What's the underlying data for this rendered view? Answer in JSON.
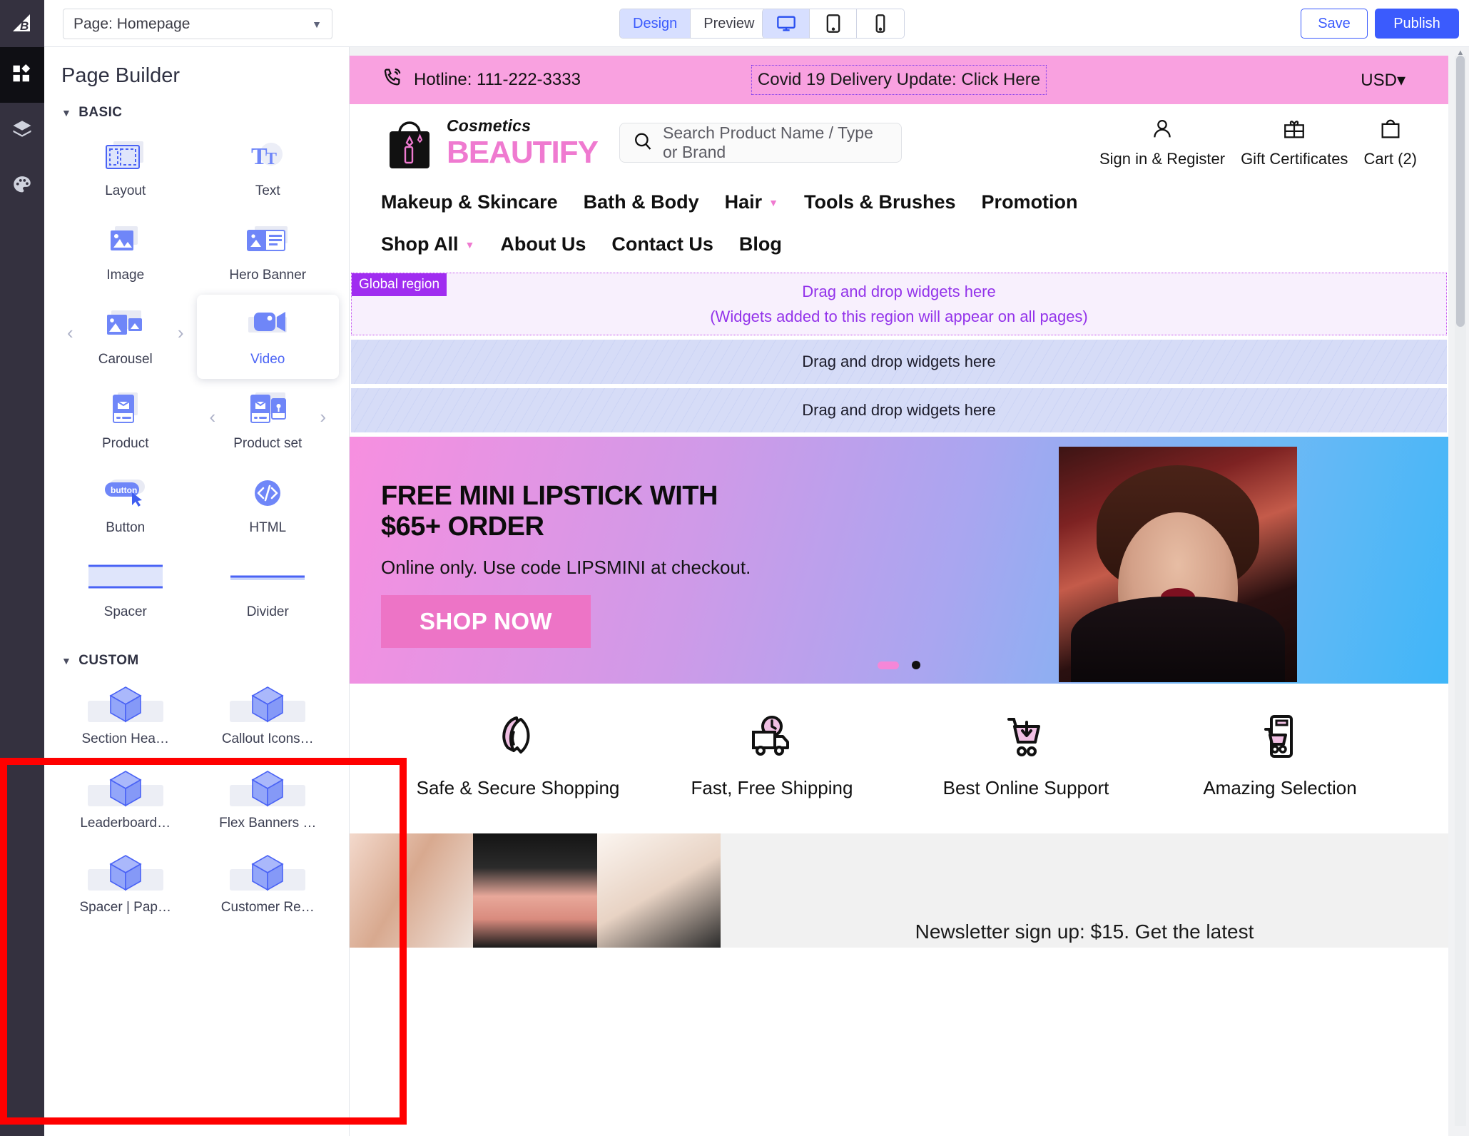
{
  "topbar": {
    "logo_icon": "bigcommerce-logo-icon",
    "page_selector": {
      "value": "Page: Homepage",
      "caret": "▼"
    },
    "mode_tabs": [
      {
        "label": "Design",
        "active": true
      },
      {
        "label": "Preview",
        "active": false
      }
    ],
    "device_tabs": [
      {
        "icon": "desktop-icon",
        "active": true
      },
      {
        "icon": "tablet-icon",
        "active": false
      },
      {
        "icon": "mobile-icon",
        "active": false
      }
    ],
    "save_label": "Save",
    "publish_label": "Publish"
  },
  "rail": {
    "items": [
      {
        "icon": "widgets-grid-icon",
        "active": true
      },
      {
        "icon": "layers-icon",
        "active": false
      },
      {
        "icon": "theme-palette-icon",
        "active": false
      }
    ]
  },
  "panel": {
    "title": "Page Builder",
    "groups": [
      {
        "name": "BASIC",
        "collapse_caret": "▼",
        "widgets": [
          {
            "label": "Layout",
            "icon": "layout-icon",
            "selected": false,
            "arrows": false
          },
          {
            "label": "Text",
            "icon": "text-icon",
            "selected": false,
            "arrows": false
          },
          {
            "label": "Image",
            "icon": "image-icon",
            "selected": false,
            "arrows": false
          },
          {
            "label": "Hero Banner",
            "icon": "hero-banner-icon",
            "selected": false,
            "arrows": false
          },
          {
            "label": "Carousel",
            "icon": "carousel-icon",
            "selected": false,
            "arrows": true
          },
          {
            "label": "Video",
            "icon": "video-icon",
            "selected": true,
            "arrows": false
          },
          {
            "label": "Product",
            "icon": "product-icon",
            "selected": false,
            "arrows": false
          },
          {
            "label": "Product set",
            "icon": "product-set-icon",
            "selected": false,
            "arrows": true
          },
          {
            "label": "Button",
            "icon": "button-icon",
            "selected": false,
            "arrows": false
          },
          {
            "label": "HTML",
            "icon": "html-code-icon",
            "selected": false,
            "arrows": false
          },
          {
            "label": "Spacer",
            "icon": "spacer-icon",
            "selected": false,
            "arrows": false
          },
          {
            "label": "Divider",
            "icon": "divider-icon",
            "selected": false,
            "arrows": false
          }
        ]
      },
      {
        "name": "CUSTOM",
        "collapse_caret": "▼",
        "widgets": [
          {
            "label": "Section Hea…",
            "icon": "cube-icon",
            "selected": false,
            "arrows": false
          },
          {
            "label": "Callout Icons…",
            "icon": "cube-icon",
            "selected": false,
            "arrows": false
          },
          {
            "label": "Leaderboard…",
            "icon": "cube-icon",
            "selected": false,
            "arrows": false
          },
          {
            "label": "Flex Banners …",
            "icon": "cube-icon",
            "selected": false,
            "arrows": false
          },
          {
            "label": "Spacer | Pap…",
            "icon": "cube-icon",
            "selected": false,
            "arrows": false
          },
          {
            "label": "Customer Re…",
            "icon": "cube-icon",
            "selected": false,
            "arrows": false
          }
        ]
      }
    ]
  },
  "canvas": {
    "hotline_bar": {
      "phone_icon": "phone-ring-icon",
      "hotline": "Hotline: 111-222-3333",
      "covid_notice": "Covid 19 Delivery Update: Click Here",
      "currency": "USD",
      "currency_caret": "▾"
    },
    "header": {
      "brand_small": "Cosmetics",
      "brand_large": "BEAUTIFY",
      "logo_icon": "cosmetics-bag-icon",
      "search_icon": "search-icon",
      "search_placeholder": "Search Product Name / Type or Brand",
      "actions": [
        {
          "icon": "user-icon",
          "label": "Sign in & Register"
        },
        {
          "icon": "gift-icon",
          "label": "Gift Certificates"
        },
        {
          "icon": "bag-icon",
          "label": "Cart (2)"
        }
      ]
    },
    "nav": [
      {
        "label": "Makeup & Skincare",
        "caret": false
      },
      {
        "label": "Bath & Body",
        "caret": false
      },
      {
        "label": "Hair",
        "caret": true
      },
      {
        "label": "Tools & Brushes",
        "caret": false
      },
      {
        "label": "Promotion",
        "caret": false
      },
      {
        "label": "Shop All",
        "caret": true
      },
      {
        "label": "About Us",
        "caret": false
      },
      {
        "label": "Contact Us",
        "caret": false
      },
      {
        "label": "Blog",
        "caret": false
      }
    ],
    "global_region": {
      "tag": "Global region",
      "line1": "Drag and drop widgets here",
      "line2": "(Widgets added to this region will appear on all pages)"
    },
    "dropzones": [
      {
        "text": "Drag and drop widgets here"
      },
      {
        "text": "Drag and drop widgets here"
      }
    ],
    "hero": {
      "headline": "FREE MINI LIPSTICK WITH $65+ ORDER",
      "subhead": "Online only. Use code LIPSMINI at checkout.",
      "cta": "SHOP NOW",
      "slide_count": 2,
      "active_slide": 1
    },
    "benefits": [
      {
        "icon": "shield-rocket-icon",
        "label": "Safe & Secure Shopping"
      },
      {
        "icon": "delivery-truck-icon",
        "label": "Fast, Free Shipping"
      },
      {
        "icon": "cart-support-icon",
        "label": "Best Online Support"
      },
      {
        "icon": "mobile-cart-icon",
        "label": "Amazing Selection"
      }
    ],
    "bottom_strip": {
      "text": "Newsletter sign up: $15. Get the latest"
    },
    "scrollbar": {
      "up": "▲",
      "down": "▼"
    }
  },
  "annotation": {
    "highlight_color": "#ff0000"
  }
}
